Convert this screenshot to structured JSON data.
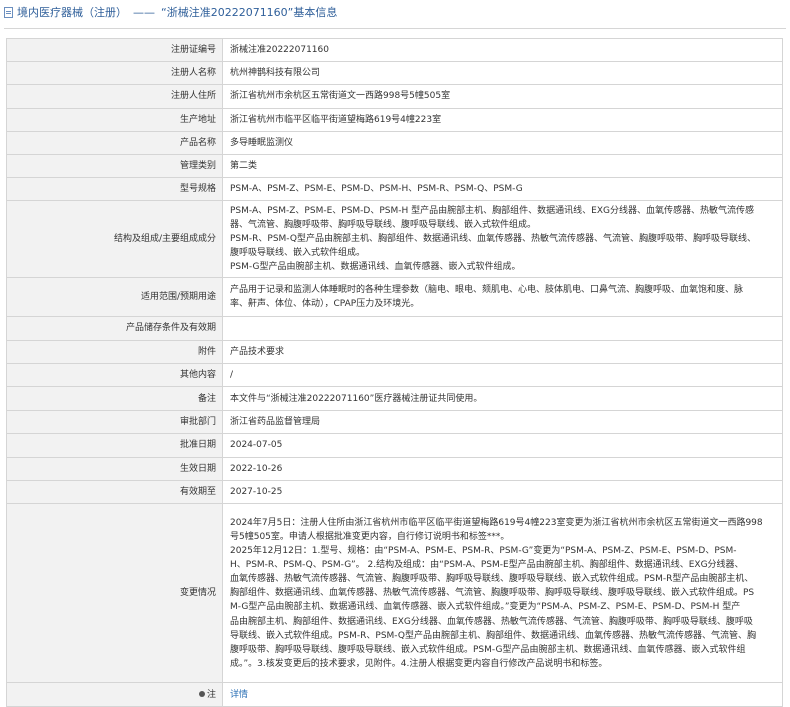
{
  "header": {
    "title_left": "境内医疗器械（注册）",
    "separator": "——",
    "title_right": "“浙械注准20222071160”基本信息"
  },
  "rows": {
    "reg_no": {
      "label": "注册证编号",
      "value": "浙械注准20222071160"
    },
    "registrant": {
      "label": "注册人名称",
      "value": "杭州神鹊科技有限公司"
    },
    "registrant_addr": {
      "label": "注册人住所",
      "value": "浙江省杭州市余杭区五常街道文一西路998号5幢505室"
    },
    "prod_addr": {
      "label": "生产地址",
      "value": "浙江省杭州市临平区临平街道望梅路619号4幢223室"
    },
    "product_name": {
      "label": "产品名称",
      "value": "多导睡眠监测仪"
    },
    "mgmt_class": {
      "label": "管理类别",
      "value": "第二类"
    },
    "models": {
      "label": "型号规格",
      "value": "PSM-A、PSM-Z、PSM-E、PSM-D、PSM-H、PSM-R、PSM-Q、PSM-G"
    },
    "structure": {
      "label": "结构及组成/主要组成成分",
      "lines": [
        "PSM-A、PSM-Z、PSM-E、PSM-D、PSM-H 型产品由腕部主机、胸部组件、数据通讯线、EXG分线器、血氧传感器、热敏气流传感",
        "器、气流管、胸腹呼吸带、胸呼吸导联线、腹呼吸导联线、嵌入式软件组成。",
        "PSM-R、PSM-Q型产品由腕部主机、胸部组件、数据通讯线、血氧传感器、热敏气流传感器、气流管、胸腹呼吸带、胸呼吸导联线、",
        "腹呼吸导联线、嵌入式软件组成。",
        "PSM-G型产品由腕部主机、数据通讯线、血氧传感器、嵌入式软件组成。"
      ]
    },
    "usage": {
      "label": "适用范围/预期用途",
      "lines": [
        "产品用于记录和监测人体睡眠时的各种生理参数（脑电、眼电、颏肌电、心电、肢体肌电、口鼻气流、胸腹呼吸、血氧饱和度、脉",
        "率、鼾声、体位、体动），CPAP压力及环境光。"
      ]
    },
    "storage": {
      "label": "产品储存条件及有效期",
      "value": ""
    },
    "attachment": {
      "label": "附件",
      "value": "产品技术要求"
    },
    "other": {
      "label": "其他内容",
      "value": "/"
    },
    "remark": {
      "label": "备注",
      "value": "本文件与“浙械注准20222071160”医疗器械注册证共同使用。"
    },
    "authority": {
      "label": "审批部门",
      "value": "浙江省药品监督管理局"
    },
    "approve_date": {
      "label": "批准日期",
      "value": "2024-07-05"
    },
    "effective_date": {
      "label": "生效日期",
      "value": "2022-10-26"
    },
    "expire_date": {
      "label": "有效期至",
      "value": "2027-10-25"
    },
    "changes": {
      "label": "变更情况",
      "lines": [
        "2024年7月5日：注册人住所由浙江省杭州市临平区临平街道望梅路619号4幢223室变更为浙江省杭州市余杭区五常街道文一西路998",
        "号5幢505室。申请人根据批准变更内容，自行修订说明书和标签***。",
        "2025年12月12日：1.型号、规格：由“PSM-A、PSM-E、PSM-R、PSM-G”变更为“PSM-A、PSM-Z、PSM-E、PSM-D、PSM-",
        "H、PSM-R、PSM-Q、PSM-G”。 2.结构及组成：由“PSM-A、PSM-E型产品由腕部主机、胸部组件、数据通讯线、EXG分线器、",
        "血氧传感器、热敏气流传感器、气流管、胸腹呼吸带、胸呼吸导联线、腹呼吸导联线、嵌入式软件组成。PSM-R型产品由腕部主机、",
        "胸部组件、数据通讯线、血氧传感器、热敏气流传感器、气流管、胸腹呼吸带、胸呼吸导联线、腹呼吸导联线、嵌入式软件组成。PS",
        "M-G型产品由腕部主机、数据通讯线、血氧传感器、嵌入式软件组成。”变更为“PSM-A、PSM-Z、PSM-E、PSM-D、PSM-H 型产",
        "品由腕部主机、胸部组件、数据通讯线、EXG分线器、血氧传感器、热敏气流传感器、气流管、胸腹呼吸带、胸呼吸导联线、腹呼吸",
        "导联线、嵌入式软件组成。PSM-R、PSM-Q型产品由腕部主机、胸部组件、数据通讯线、血氧传感器、热敏气流传感器、气流管、胸",
        "腹呼吸带、胸呼吸导联线、腹呼吸导联线、嵌入式软件组成。PSM-G型产品由腕部主机、数据通讯线、血氧传感器、嵌入式软件组",
        "成。”。3.核发变更后的技术要求，见附件。4.注册人根据变更内容自行修改产品说明书和标签。"
      ]
    },
    "note": {
      "label": "注",
      "link": "详情"
    }
  }
}
